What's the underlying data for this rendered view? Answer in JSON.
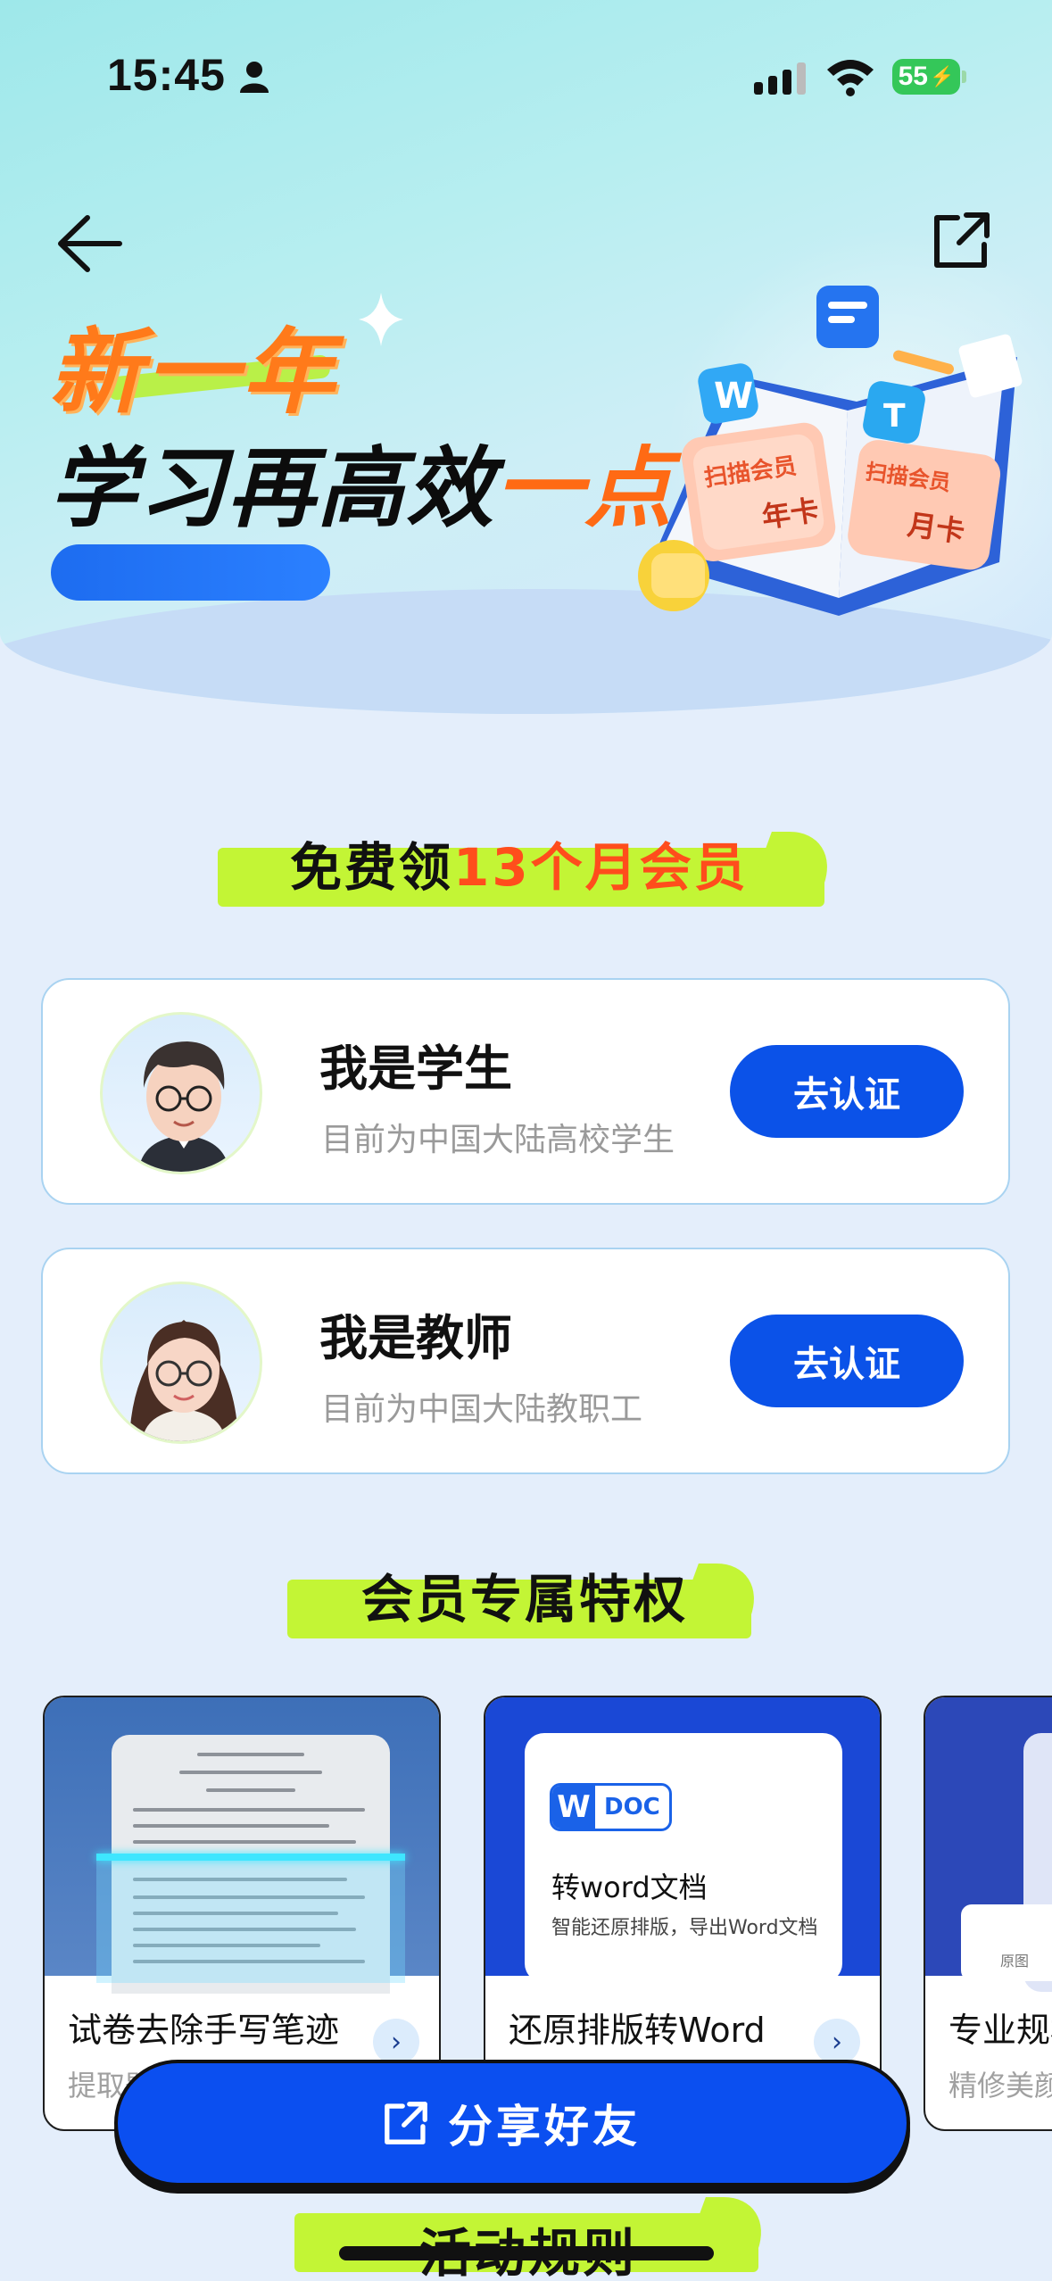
{
  "status_bar": {
    "time": "15:45",
    "battery": "55"
  },
  "hero": {
    "line1": "新一年",
    "line2_main": "学习再高效",
    "line2_highlight": "一点",
    "badge_text_1": "扫描会员",
    "badge_text_2": "年卡",
    "badge_text_3": "扫描会员",
    "badge_text_4": "月卡"
  },
  "section_free": {
    "prefix": "免费领",
    "highlight": "13个月会员"
  },
  "roles": [
    {
      "title": "我是学生",
      "subtitle": "目前为中国大陆高校学生",
      "button": "去认证"
    },
    {
      "title": "我是教师",
      "subtitle": "目前为中国大陆教职工",
      "button": "去认证"
    }
  ],
  "section_privileges": {
    "title": "会员专属特权"
  },
  "features": [
    {
      "title": "试卷去除手写笔迹",
      "subtitle": "提取题目",
      "arrow": "›"
    },
    {
      "title": "还原排版转Word",
      "subtitle": "",
      "arrow": "›",
      "doc_badge": "DOC",
      "doc_w": "W",
      "doc_title": "转word文档",
      "doc_sub": "智能还原排版，导出Word文档"
    },
    {
      "title": "专业规格",
      "subtitle": "精修美颜",
      "orig_label": "原图"
    }
  ],
  "share_button": {
    "label": "分享好友"
  },
  "section_rules": {
    "title": "活动规则"
  },
  "colors": {
    "primary": "#0b52e8",
    "accent_green": "#c3f535",
    "accent_orange": "#ff6a14"
  }
}
